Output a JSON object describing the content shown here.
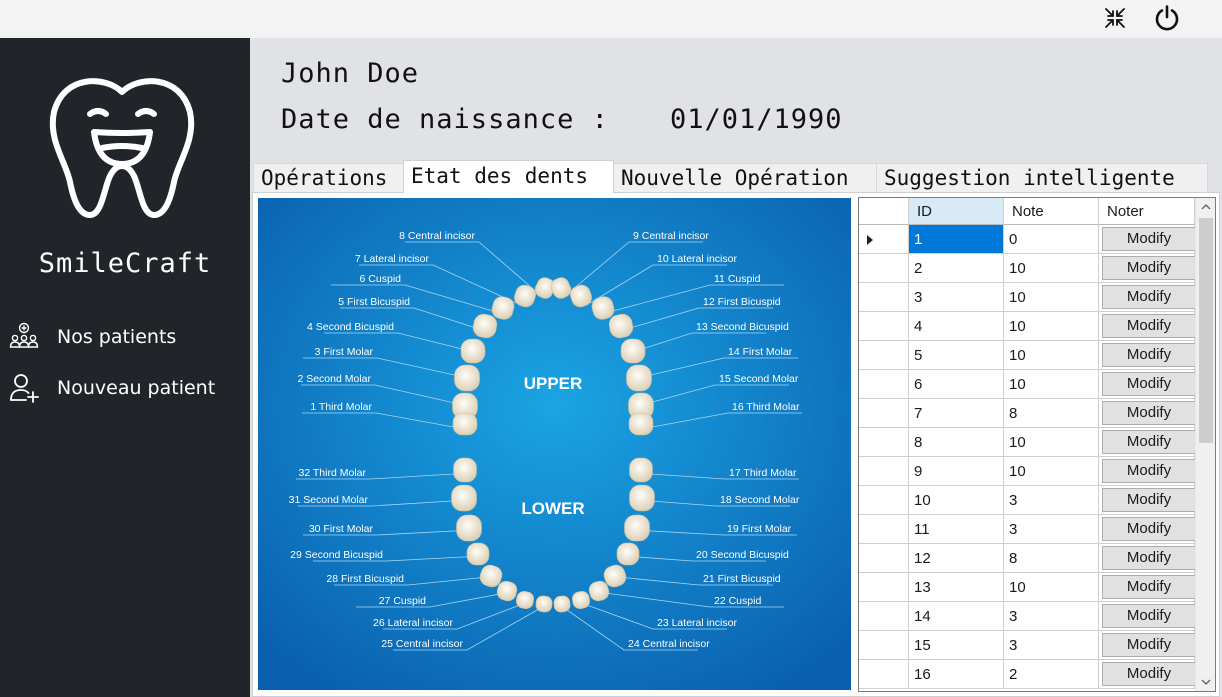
{
  "app": {
    "brand": "SmileCraft",
    "icons": {
      "minimize": "collapse-arrows-icon",
      "power": "power-icon",
      "logo": "smiling-tooth-logo"
    }
  },
  "sidebar": {
    "items": [
      {
        "label": "Nos patients",
        "icon": "patients-group-icon"
      },
      {
        "label": "Nouveau patient",
        "icon": "add-user-icon"
      }
    ]
  },
  "patient": {
    "name": "John Doe",
    "dob_label": "Date de naissance :",
    "dob_value": "01/01/1990"
  },
  "tabs": [
    {
      "label": "Opérations",
      "active": false
    },
    {
      "label": "Etat des dents",
      "active": true
    },
    {
      "label": "Nouvelle Opération",
      "active": false
    },
    {
      "label": "Suggestion intelligente",
      "active": false
    }
  ],
  "chart": {
    "upper_label": "UPPER",
    "lower_label": "LOWER",
    "left_labels": [
      "8 Central incisor",
      "7 Lateral incisor",
      "6 Cuspid",
      "5 First Bicuspid",
      "4 Second Bicuspid",
      "3 First Molar",
      "2 Second Molar",
      "1 Third Molar",
      "32 Third Molar",
      "31 Second Molar",
      "30 First Molar",
      "29 Second Bicuspid",
      "28 First Bicuspid",
      "27 Cuspid",
      "26 Lateral incisor",
      "25 Central incisor"
    ],
    "right_labels": [
      "9 Central incisor",
      "10 Lateral incisor",
      "11 Cuspid",
      "12 First Bicuspid",
      "13 Second Bicuspid",
      "14 First Molar",
      "15 Second Molar",
      "16 Third Molar",
      "17 Third Molar",
      "18 Second Molar",
      "19 First Molar",
      "20 Second Bicuspid",
      "21 First Bicuspid",
      "22 Cuspid",
      "23 Lateral incisor",
      "24 Central incisor"
    ],
    "colors": {
      "bg_light": "#1aa4e4",
      "bg_dark": "#0a5fae",
      "tooth": "#f3ecdc"
    }
  },
  "grid": {
    "columns": [
      "ID",
      "Note",
      "Noter"
    ],
    "button_label": "Modify",
    "selected_row": 0,
    "rows": [
      {
        "id": "1",
        "note": "0"
      },
      {
        "id": "2",
        "note": "10"
      },
      {
        "id": "3",
        "note": "10"
      },
      {
        "id": "4",
        "note": "10"
      },
      {
        "id": "5",
        "note": "10"
      },
      {
        "id": "6",
        "note": "10"
      },
      {
        "id": "7",
        "note": "8"
      },
      {
        "id": "8",
        "note": "10"
      },
      {
        "id": "9",
        "note": "10"
      },
      {
        "id": "10",
        "note": "3"
      },
      {
        "id": "11",
        "note": "3"
      },
      {
        "id": "12",
        "note": "8"
      },
      {
        "id": "13",
        "note": "10"
      },
      {
        "id": "14",
        "note": "3"
      },
      {
        "id": "15",
        "note": "3"
      },
      {
        "id": "16",
        "note": "2"
      }
    ]
  }
}
